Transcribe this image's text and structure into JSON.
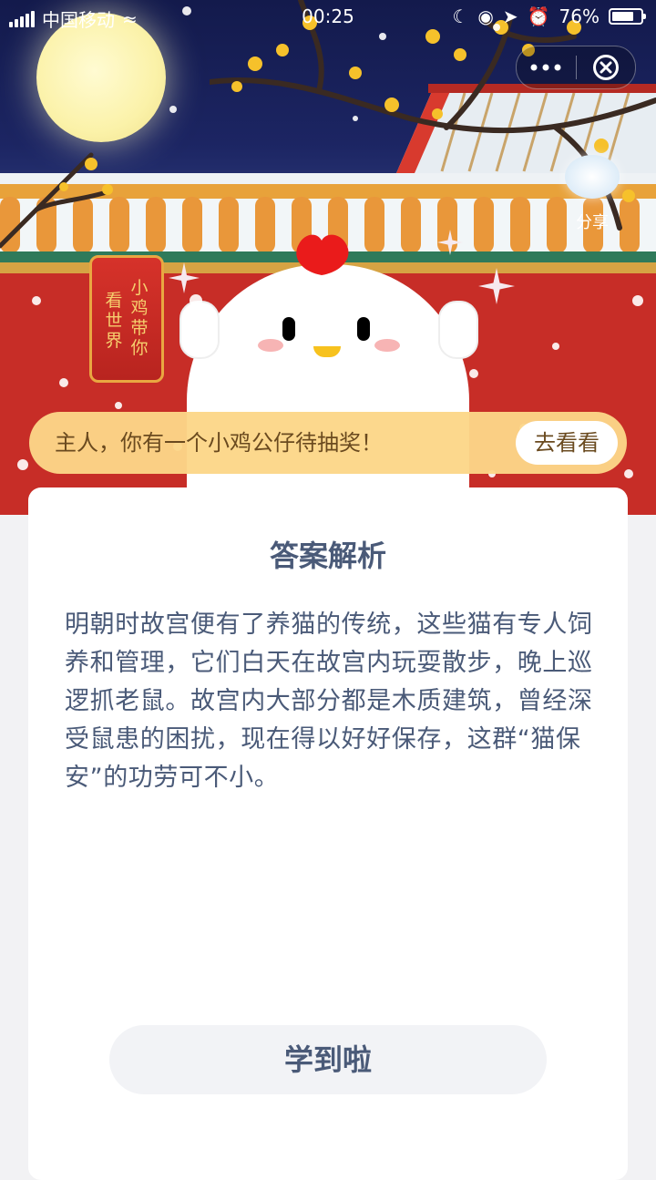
{
  "status_bar": {
    "carrier": "中国移动",
    "time": "00:25",
    "battery": "76%",
    "battery_level": 0.76
  },
  "capsule": {
    "more_icon": "more-dots-icon",
    "close_icon": "close-circle-icon"
  },
  "hero": {
    "tag_text": [
      "小鸡带你",
      "看世界"
    ],
    "share_label": "分享"
  },
  "banner": {
    "message": "主人，你有一个小鸡公仔待抽奖！",
    "button_label": "去看看"
  },
  "card": {
    "title": "答案解析",
    "body": "明朝时故宫便有了养猫的传统，这些猫有专人饲养和管理，它们白天在故宫内玩耍散步，晚上巡逻抓老鼠。故宫内大部分都是木质建筑，曾经深受鼠患的困扰，现在得以好好保存，这群“猫保安”的功劳可不小。",
    "button_label": "学到啦"
  },
  "colors": {
    "night_sky": "#1c2563",
    "wall_red": "#c72d27",
    "banner_bg": "#fcd688",
    "text_primary": "#4a5a78"
  }
}
